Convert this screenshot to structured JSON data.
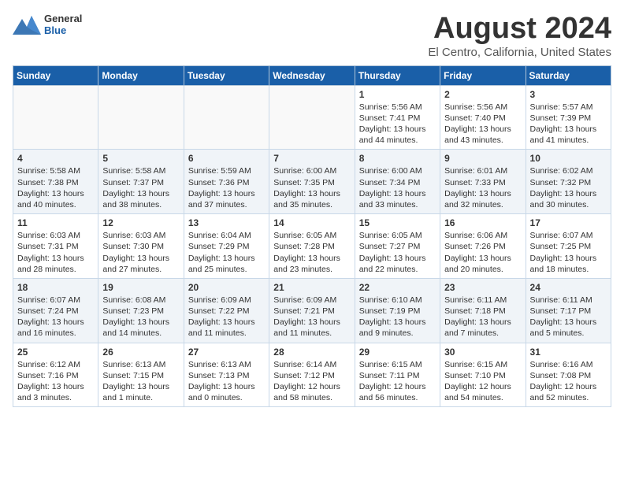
{
  "logo": {
    "line1": "General",
    "line2": "Blue"
  },
  "title": "August 2024",
  "subtitle": "El Centro, California, United States",
  "weekdays": [
    "Sunday",
    "Monday",
    "Tuesday",
    "Wednesday",
    "Thursday",
    "Friday",
    "Saturday"
  ],
  "weeks": [
    [
      {
        "day": "",
        "content": ""
      },
      {
        "day": "",
        "content": ""
      },
      {
        "day": "",
        "content": ""
      },
      {
        "day": "",
        "content": ""
      },
      {
        "day": "1",
        "content": "Sunrise: 5:56 AM\nSunset: 7:41 PM\nDaylight: 13 hours\nand 44 minutes."
      },
      {
        "day": "2",
        "content": "Sunrise: 5:56 AM\nSunset: 7:40 PM\nDaylight: 13 hours\nand 43 minutes."
      },
      {
        "day": "3",
        "content": "Sunrise: 5:57 AM\nSunset: 7:39 PM\nDaylight: 13 hours\nand 41 minutes."
      }
    ],
    [
      {
        "day": "4",
        "content": "Sunrise: 5:58 AM\nSunset: 7:38 PM\nDaylight: 13 hours\nand 40 minutes."
      },
      {
        "day": "5",
        "content": "Sunrise: 5:58 AM\nSunset: 7:37 PM\nDaylight: 13 hours\nand 38 minutes."
      },
      {
        "day": "6",
        "content": "Sunrise: 5:59 AM\nSunset: 7:36 PM\nDaylight: 13 hours\nand 37 minutes."
      },
      {
        "day": "7",
        "content": "Sunrise: 6:00 AM\nSunset: 7:35 PM\nDaylight: 13 hours\nand 35 minutes."
      },
      {
        "day": "8",
        "content": "Sunrise: 6:00 AM\nSunset: 7:34 PM\nDaylight: 13 hours\nand 33 minutes."
      },
      {
        "day": "9",
        "content": "Sunrise: 6:01 AM\nSunset: 7:33 PM\nDaylight: 13 hours\nand 32 minutes."
      },
      {
        "day": "10",
        "content": "Sunrise: 6:02 AM\nSunset: 7:32 PM\nDaylight: 13 hours\nand 30 minutes."
      }
    ],
    [
      {
        "day": "11",
        "content": "Sunrise: 6:03 AM\nSunset: 7:31 PM\nDaylight: 13 hours\nand 28 minutes."
      },
      {
        "day": "12",
        "content": "Sunrise: 6:03 AM\nSunset: 7:30 PM\nDaylight: 13 hours\nand 27 minutes."
      },
      {
        "day": "13",
        "content": "Sunrise: 6:04 AM\nSunset: 7:29 PM\nDaylight: 13 hours\nand 25 minutes."
      },
      {
        "day": "14",
        "content": "Sunrise: 6:05 AM\nSunset: 7:28 PM\nDaylight: 13 hours\nand 23 minutes."
      },
      {
        "day": "15",
        "content": "Sunrise: 6:05 AM\nSunset: 7:27 PM\nDaylight: 13 hours\nand 22 minutes."
      },
      {
        "day": "16",
        "content": "Sunrise: 6:06 AM\nSunset: 7:26 PM\nDaylight: 13 hours\nand 20 minutes."
      },
      {
        "day": "17",
        "content": "Sunrise: 6:07 AM\nSunset: 7:25 PM\nDaylight: 13 hours\nand 18 minutes."
      }
    ],
    [
      {
        "day": "18",
        "content": "Sunrise: 6:07 AM\nSunset: 7:24 PM\nDaylight: 13 hours\nand 16 minutes."
      },
      {
        "day": "19",
        "content": "Sunrise: 6:08 AM\nSunset: 7:23 PM\nDaylight: 13 hours\nand 14 minutes."
      },
      {
        "day": "20",
        "content": "Sunrise: 6:09 AM\nSunset: 7:22 PM\nDaylight: 13 hours\nand 11 minutes."
      },
      {
        "day": "21",
        "content": "Sunrise: 6:09 AM\nSunset: 7:21 PM\nDaylight: 13 hours\nand 11 minutes."
      },
      {
        "day": "22",
        "content": "Sunrise: 6:10 AM\nSunset: 7:19 PM\nDaylight: 13 hours\nand 9 minutes."
      },
      {
        "day": "23",
        "content": "Sunrise: 6:11 AM\nSunset: 7:18 PM\nDaylight: 13 hours\nand 7 minutes."
      },
      {
        "day": "24",
        "content": "Sunrise: 6:11 AM\nSunset: 7:17 PM\nDaylight: 13 hours\nand 5 minutes."
      }
    ],
    [
      {
        "day": "25",
        "content": "Sunrise: 6:12 AM\nSunset: 7:16 PM\nDaylight: 13 hours\nand 3 minutes."
      },
      {
        "day": "26",
        "content": "Sunrise: 6:13 AM\nSunset: 7:15 PM\nDaylight: 13 hours\nand 1 minute."
      },
      {
        "day": "27",
        "content": "Sunrise: 6:13 AM\nSunset: 7:13 PM\nDaylight: 13 hours\nand 0 minutes."
      },
      {
        "day": "28",
        "content": "Sunrise: 6:14 AM\nSunset: 7:12 PM\nDaylight: 12 hours\nand 58 minutes."
      },
      {
        "day": "29",
        "content": "Sunrise: 6:15 AM\nSunset: 7:11 PM\nDaylight: 12 hours\nand 56 minutes."
      },
      {
        "day": "30",
        "content": "Sunrise: 6:15 AM\nSunset: 7:10 PM\nDaylight: 12 hours\nand 54 minutes."
      },
      {
        "day": "31",
        "content": "Sunrise: 6:16 AM\nSunset: 7:08 PM\nDaylight: 12 hours\nand 52 minutes."
      }
    ]
  ]
}
